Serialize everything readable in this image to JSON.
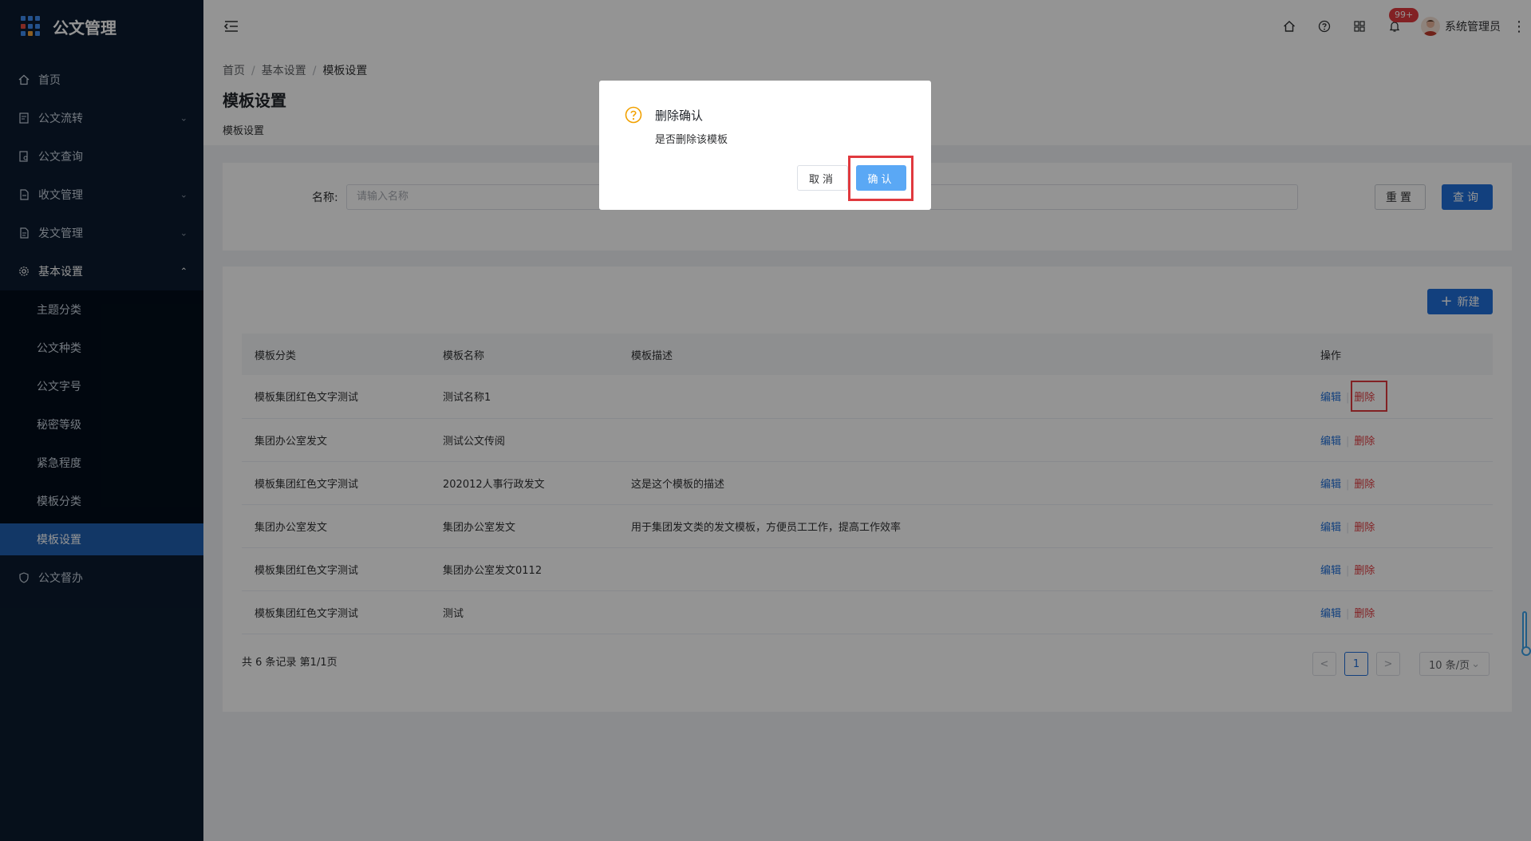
{
  "brand": {
    "title": "公文管理"
  },
  "colors": {
    "sidebar_bg": "#0b1b2f",
    "sidebar_active": "#1f5fb0",
    "primary": "#1f6fd9",
    "danger": "#e0393e",
    "confirm_button": "#5aa8f5"
  },
  "sidebar": {
    "items": [
      {
        "label": "首页",
        "icon": "home-icon"
      },
      {
        "label": "公文流转",
        "icon": "document-flow-icon",
        "expandable": true
      },
      {
        "label": "公文查询",
        "icon": "document-search-icon"
      },
      {
        "label": "收文管理",
        "icon": "inbox-document-icon",
        "expandable": true
      },
      {
        "label": "发文管理",
        "icon": "outbox-document-icon",
        "expandable": true
      },
      {
        "label": "基本设置",
        "icon": "gear-icon",
        "expanded": true
      },
      {
        "label": "公文督办",
        "icon": "shield-icon"
      }
    ],
    "submenu": [
      {
        "label": "主题分类"
      },
      {
        "label": "公文种类"
      },
      {
        "label": "公文字号"
      },
      {
        "label": "秘密等级"
      },
      {
        "label": "紧急程度"
      },
      {
        "label": "模板分类"
      },
      {
        "label": "模板设置",
        "active": true
      }
    ]
  },
  "header": {
    "notification_badge": "99+",
    "username": "系统管理员",
    "icons": [
      "home-icon",
      "help-icon",
      "apps-icon",
      "bell-icon",
      "more-icon"
    ]
  },
  "breadcrumb": [
    "首页",
    "基本设置",
    "模板设置"
  ],
  "page": {
    "title": "模板设置",
    "description": "模板设置"
  },
  "search": {
    "label": "名称:",
    "placeholder": "请输入名称",
    "reset_label": "重置",
    "query_label": "查询"
  },
  "table": {
    "new_label": "新建",
    "columns": [
      "模板分类",
      "模板名称",
      "模板描述",
      "操作"
    ],
    "edit_label": "编辑",
    "delete_label": "删除",
    "rows": [
      {
        "category": "模板集团红色文字测试",
        "name": "测试名称1",
        "desc": ""
      },
      {
        "category": "集团办公室发文",
        "name": "测试公文传阅",
        "desc": ""
      },
      {
        "category": "模板集团红色文字测试",
        "name": "202012人事行政发文",
        "desc": "这是这个模板的描述"
      },
      {
        "category": "集团办公室发文",
        "name": "集团办公室发文",
        "desc": "用于集团发文类的发文模板，方便员工工作，提高工作效率"
      },
      {
        "category": "模板集团红色文字测试",
        "name": "集团办公室发文0112",
        "desc": ""
      },
      {
        "category": "模板集团红色文字测试",
        "name": "测试",
        "desc": ""
      }
    ]
  },
  "pagination": {
    "summary": "共 6 条记录 第1/1页",
    "current_page": "1",
    "prev": "<",
    "next": ">",
    "page_size": "10 条/页"
  },
  "modal": {
    "title": "删除确认",
    "message": "是否删除该模板",
    "cancel_label": "取消",
    "confirm_label": "确认"
  }
}
